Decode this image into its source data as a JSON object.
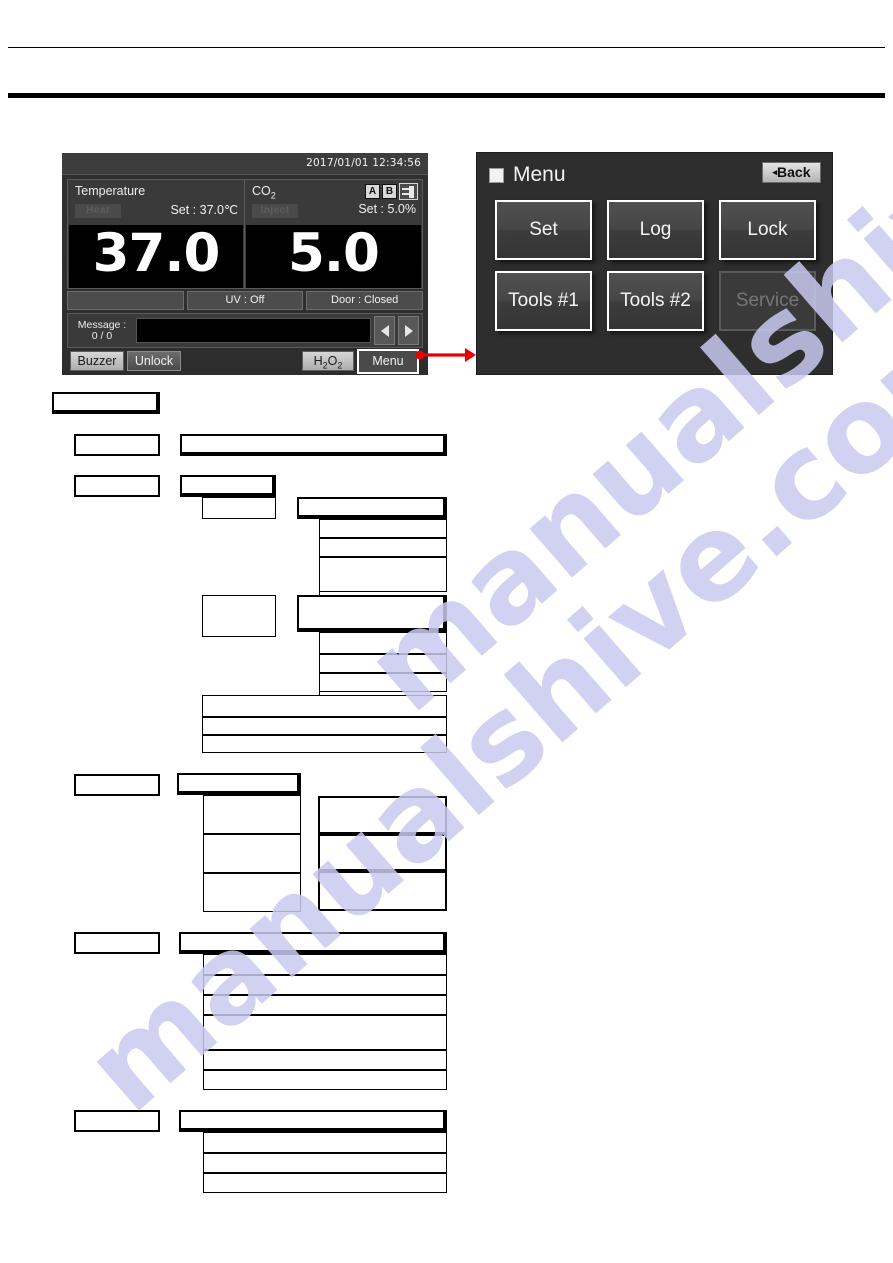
{
  "page": {
    "watermark": "manualshive.com"
  },
  "main_screen": {
    "name": "operation-screen",
    "clock": "2017/01/01  12:34:56",
    "temperature": {
      "label": "Temperature",
      "badge": "Heat",
      "setpoint": "Set : 37.0℃",
      "value": "37.0"
    },
    "co2": {
      "label_main": "CO",
      "label_sub": "2",
      "badge": "Inject",
      "bottle_a": "A",
      "bottle_b": "B",
      "gas_icon": "gas-cylinder-icon",
      "setpoint": "Set :  5.0%",
      "value": "5.0"
    },
    "status": {
      "blank": "",
      "uv": "UV : Off",
      "door": "Door : Closed"
    },
    "message": {
      "label_line1": "Message :",
      "label_line2": "0 / 0",
      "text": "",
      "prev_icon": "triangle-left-icon",
      "next_icon": "triangle-right-icon"
    },
    "buttons": {
      "buzzer": "Buzzer",
      "unlock": "Unlock",
      "h2o2_main": "H",
      "h2o2_sub": "2",
      "h2o2_tail": "O",
      "h2o2_sub2": "2",
      "menu": "Menu"
    }
  },
  "menu_screen": {
    "name": "menu-screen",
    "square_icon": "white-square-icon",
    "title": "Menu",
    "back_caret": "◂",
    "back_label": "Back",
    "buttons": [
      {
        "label": "Set",
        "disabled": false
      },
      {
        "label": "Log",
        "disabled": false
      },
      {
        "label": "Lock",
        "disabled": false
      },
      {
        "label": "Tools #1",
        "disabled": false
      },
      {
        "label": "Tools #2",
        "disabled": false
      },
      {
        "label": "Service",
        "disabled": true
      }
    ]
  },
  "flowchart": {
    "name": "menu-tree-diagram",
    "note": "blank menu-tree template; boxes contain no printed text",
    "boxes": [
      {
        "id": "root",
        "label": ""
      },
      {
        "id": "l1-a",
        "label": ""
      },
      {
        "id": "r1-a",
        "label": ""
      },
      {
        "id": "l1-b",
        "label": ""
      },
      {
        "id": "r2-head",
        "label": ""
      },
      {
        "id": "r2-sub",
        "label": ""
      },
      {
        "id": "c3-head",
        "label": ""
      },
      {
        "id": "c3-r1",
        "label": ""
      },
      {
        "id": "c3-r2",
        "label": ""
      },
      {
        "id": "c3-r3",
        "label": ""
      },
      {
        "id": "r2b-sub",
        "label": ""
      },
      {
        "id": "c3b-head",
        "label": ""
      },
      {
        "id": "c3b-r1",
        "label": ""
      },
      {
        "id": "c3b-r2",
        "label": ""
      },
      {
        "id": "c3b-r3",
        "label": ""
      },
      {
        "id": "w1",
        "label": ""
      },
      {
        "id": "w2",
        "label": ""
      },
      {
        "id": "w3",
        "label": ""
      },
      {
        "id": "l2",
        "label": ""
      },
      {
        "id": "t-head",
        "label": ""
      },
      {
        "id": "t-r1",
        "label": ""
      },
      {
        "id": "t-r2",
        "label": ""
      },
      {
        "id": "t-r3",
        "label": ""
      },
      {
        "id": "t-s1",
        "label": ""
      },
      {
        "id": "t-s2",
        "label": ""
      },
      {
        "id": "t-s3",
        "label": ""
      },
      {
        "id": "l3",
        "label": ""
      },
      {
        "id": "g-head",
        "label": ""
      },
      {
        "id": "g-r1",
        "label": ""
      },
      {
        "id": "g-r2",
        "label": ""
      },
      {
        "id": "g-r3",
        "label": ""
      },
      {
        "id": "g-r4",
        "label": ""
      },
      {
        "id": "g-r5",
        "label": ""
      },
      {
        "id": "g-r6",
        "label": ""
      },
      {
        "id": "l4",
        "label": ""
      },
      {
        "id": "h-head",
        "label": ""
      },
      {
        "id": "h-r1",
        "label": ""
      },
      {
        "id": "h-r2",
        "label": ""
      },
      {
        "id": "h-r3",
        "label": ""
      }
    ]
  }
}
